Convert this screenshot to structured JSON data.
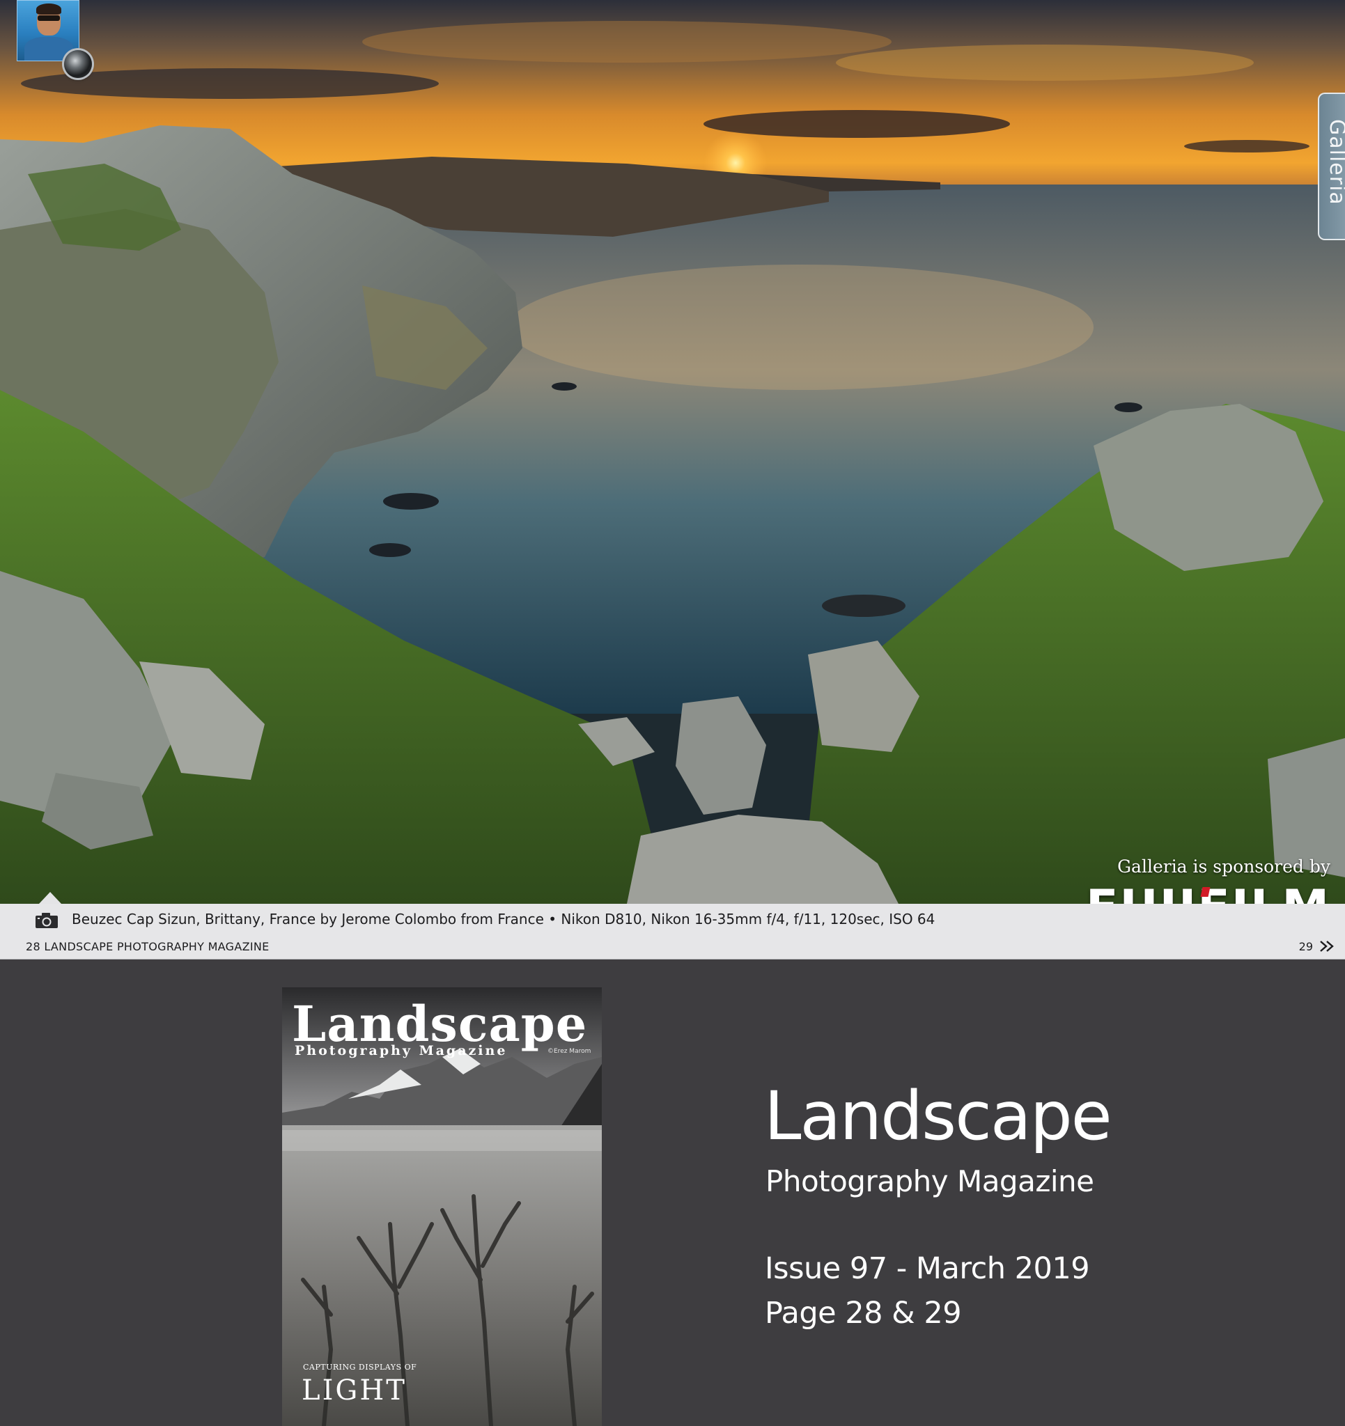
{
  "photo": {
    "gallery_tab_label": "Galleria",
    "sponsor_text": "Galleria is sponsored by",
    "sponsor_logo": "FUJIFILM",
    "icons": {
      "avatar": "photographer-avatar",
      "lens": "lens-icon",
      "home": "home-notch-icon"
    }
  },
  "caption": {
    "text": "Beuzec Cap Sizun, Brittany, France by Jerome Colombo from France • Nikon D810, Nikon 16-35mm f/4, f/11, 120sec, ISO 64",
    "page_left": "28 LANDSCAPE PHOTOGRAPHY MAGAZINE",
    "page_right": "29",
    "icons": {
      "camera": "camera-icon",
      "next": "double-chevron-right-icon"
    }
  },
  "cover": {
    "title": "Landscape",
    "subtitle": "Photography Magazine",
    "credit": "©Erez Marom",
    "kicker": "CAPTURING DISPLAYS OF",
    "headline": "LIGHT"
  },
  "info": {
    "title": "Landscape",
    "subtitle": "Photography Magazine",
    "issue": "Issue 97 - March 2019",
    "pages": "Page 28 & 29"
  },
  "colors": {
    "background": "#3e3d40",
    "caption_bar": "#e6e6e8",
    "fujifilm_red": "#d21a26"
  }
}
